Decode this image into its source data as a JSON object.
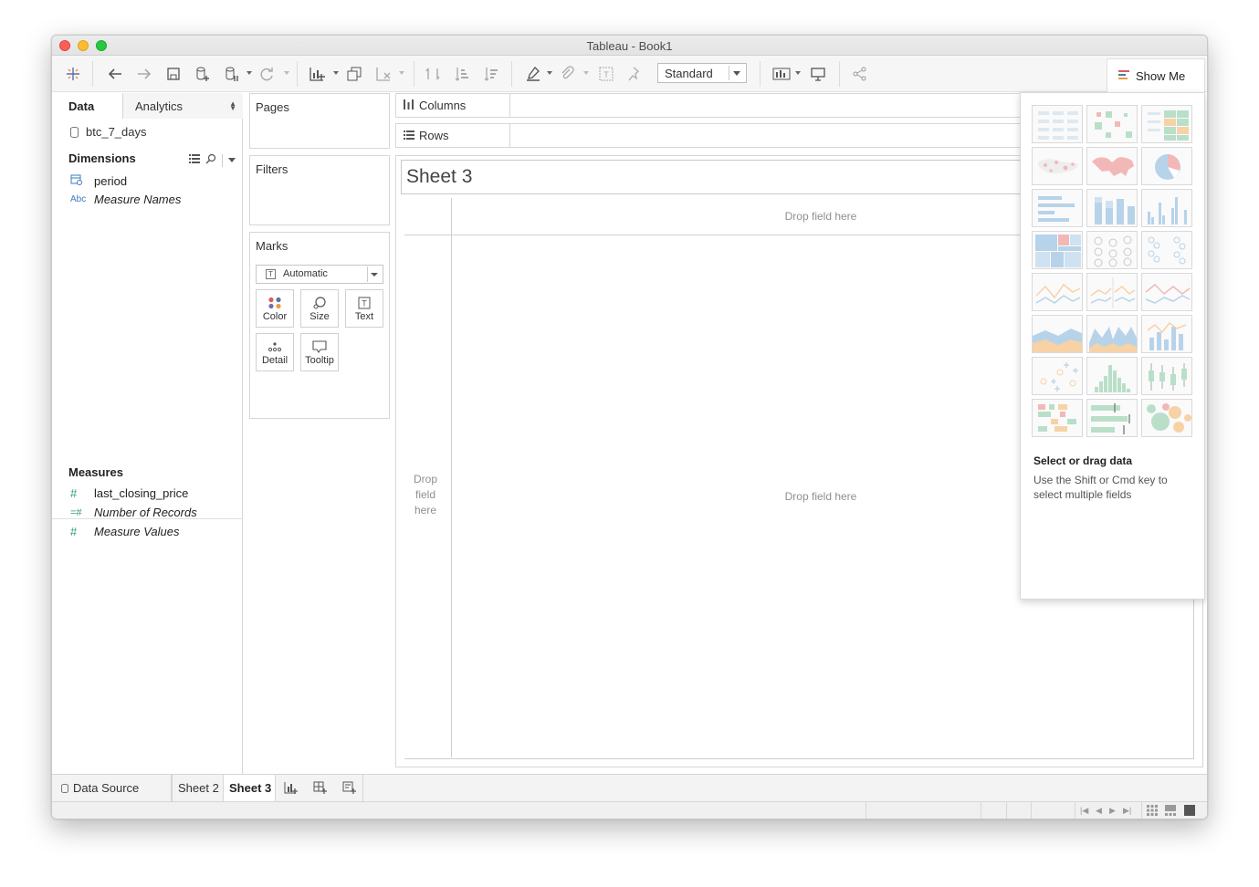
{
  "window": {
    "title": "Tableau - Book1"
  },
  "toolbar": {
    "fit_value": "Standard",
    "show_me_label": "Show Me",
    "show_me_colors": [
      "#d95c5c",
      "#4e79a7",
      "#e89c43"
    ]
  },
  "data_pane": {
    "tab_data": "Data",
    "tab_analytics": "Analytics",
    "datasource": "btc_7_days",
    "dimensions_header": "Dimensions",
    "dimensions": [
      {
        "icon": "calendar-icon",
        "type_glyph": "",
        "label": "period"
      },
      {
        "icon": "string-type-icon",
        "type_glyph": "Abc",
        "label": "Measure Names"
      }
    ],
    "measures_header": "Measures",
    "measures": [
      {
        "icon": "number-type-icon",
        "type_glyph": "#",
        "label": "last_closing_price"
      },
      {
        "icon": "number-type-icon",
        "type_glyph": "=#",
        "label": "Number of Records"
      },
      {
        "icon": "number-type-icon",
        "type_glyph": "#",
        "label": "Measure Values"
      }
    ]
  },
  "shelves": {
    "pages": "Pages",
    "filters": "Filters",
    "marks": "Marks",
    "mark_type": "Automatic",
    "mark_type_glyph": "T",
    "mark_buttons": {
      "color": "Color",
      "size": "Size",
      "text": "Text",
      "detail": "Detail",
      "tooltip": "Tooltip"
    },
    "columns": "Columns",
    "rows": "Rows"
  },
  "view": {
    "sheet_title": "Sheet 3",
    "drop_top": "Drop field here",
    "drop_left": "Drop field here",
    "drop_center": "Drop field here"
  },
  "show_me": {
    "heading": "Select or drag data",
    "hint": "Use the Shift or Cmd key to select multiple fields",
    "chart_types": [
      "text-table",
      "heat-map",
      "highlight-table",
      "symbol-map",
      "filled-map",
      "pie-chart",
      "horizontal-bars",
      "stacked-bars",
      "side-by-side-bars",
      "treemap",
      "circle-views",
      "side-by-side-circles",
      "continuous-lines",
      "discrete-lines",
      "dual-lines",
      "area-continuous",
      "area-discrete",
      "dual-combination",
      "scatter-plot",
      "histogram",
      "box-and-whisker",
      "gantt-chart",
      "bullet-graph",
      "packed-bubbles"
    ],
    "colors": {
      "blue": "#b7d3ea",
      "red": "#f2b8b8",
      "green": "#b9dfc9",
      "orange": "#f7d2a6"
    }
  },
  "bottom": {
    "datasource_tab": "Data Source",
    "sheets": [
      "Sheet 2",
      "Sheet 3"
    ],
    "active_sheet": "Sheet 3"
  }
}
